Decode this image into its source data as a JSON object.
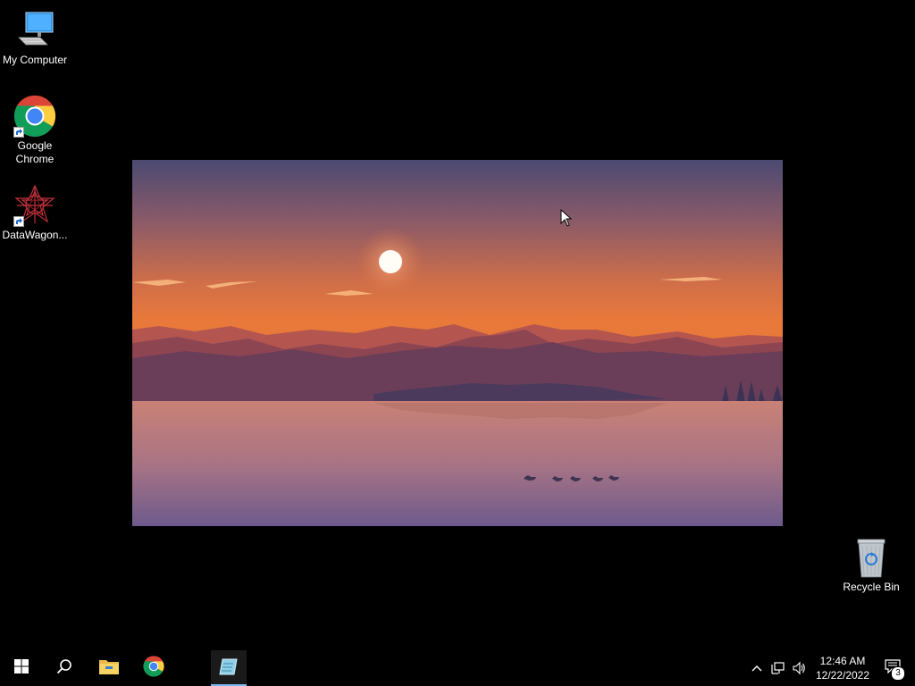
{
  "desktop": {
    "icons": [
      {
        "label": "My Computer",
        "icon": "computer-icon"
      },
      {
        "label": "Google Chrome",
        "icon": "chrome-icon"
      },
      {
        "label": "DataWagon...",
        "icon": "datawagon-icon"
      },
      {
        "label": "Recycle Bin",
        "icon": "recycle-bin-icon"
      }
    ]
  },
  "taskbar": {
    "apps": [
      {
        "icon": "windows-start-icon"
      },
      {
        "icon": "search-icon"
      },
      {
        "icon": "file-explorer-icon"
      },
      {
        "icon": "chrome-icon"
      },
      {
        "icon": "notepad-icon",
        "active": true
      }
    ],
    "clock": {
      "time": "12:46 AM",
      "date": "12/22/2022"
    },
    "notifications": {
      "count": "3"
    }
  },
  "colors": {
    "accent": "#76b9ed",
    "sky_top": "#4a4c72",
    "sky_bottom": "#e07a3c",
    "water": "#b77a7e"
  }
}
